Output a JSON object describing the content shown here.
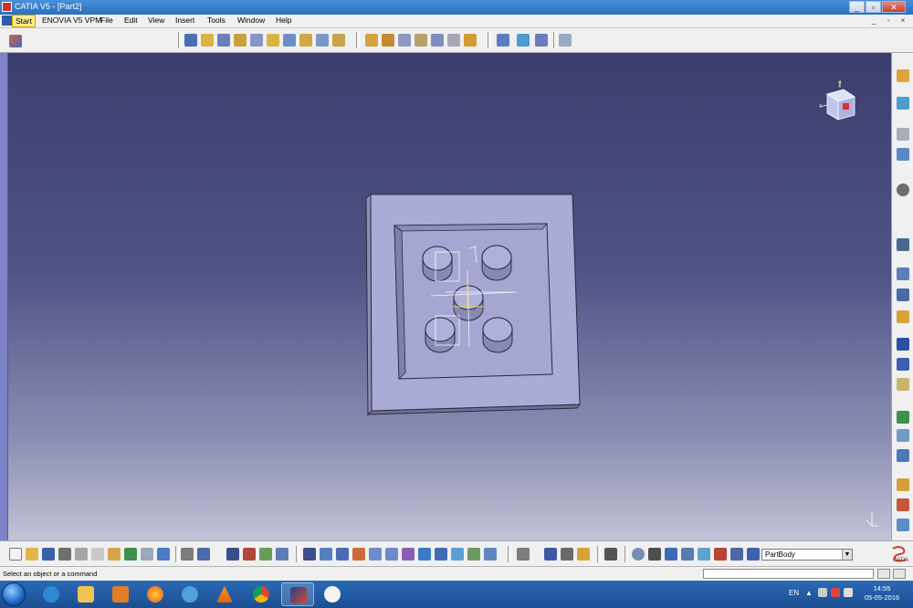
{
  "window": {
    "title": "CATIA V5 - [Part2]",
    "controls": {
      "minimize": "_",
      "restore": "▫",
      "close": "✕"
    }
  },
  "menubar": {
    "items": [
      "Start",
      "ENOVIA V5 VPM",
      "File",
      "Edit",
      "View",
      "Insert",
      "Tools",
      "Window",
      "Help"
    ],
    "active_item": "Start",
    "mdi_controls": {
      "minimize": "_",
      "restore": "▫",
      "close": "×"
    }
  },
  "toolbar_top": {
    "icons": [
      "sketcher-icon",
      "pad-icon",
      "pocket-icon",
      "shaft-icon",
      "groove-icon",
      "hole-icon",
      "rib-icon",
      "slot-icon",
      "stiffener-icon",
      "loft-icon",
      "fillet-icon",
      "chamfer-icon",
      "draft-icon",
      "shell-icon",
      "thickness-icon",
      "thread-icon",
      "remove-face-icon",
      "measure-icon",
      "apply-material-icon",
      "constraint-icon",
      "analysis-icon"
    ]
  },
  "viewport": {
    "compass": {
      "x_label": "x",
      "y_label": "y"
    }
  },
  "right_toolbar": {
    "icons": [
      "select-icon",
      "sketch-icon",
      "reference-plane-icon",
      "axis-system-icon",
      "boolean-icon",
      "constraint-icon",
      "point-icon",
      "line-icon",
      "plane-icon",
      "translate-icon",
      "rotate-icon",
      "symmetry-icon",
      "pattern-icon",
      "scale-icon",
      "knowledge-icon"
    ]
  },
  "bottom_toolbar": {
    "body_selector": {
      "value": "PartBody",
      "arrow": "▼"
    },
    "brand": "CATIA"
  },
  "statusbar": {
    "message": "Select an object or a command"
  },
  "taskbar": {
    "apps": [
      "internet-explorer-icon",
      "file-explorer-icon",
      "media-player-icon",
      "firefox-icon",
      "vlc-icon",
      "chrome-icon",
      "catia-icon",
      "paint-icon"
    ],
    "active_app": "catia-icon",
    "tray": {
      "language": "EN"
    },
    "clock": {
      "time": "14:55",
      "date": "05-05-2016"
    }
  }
}
